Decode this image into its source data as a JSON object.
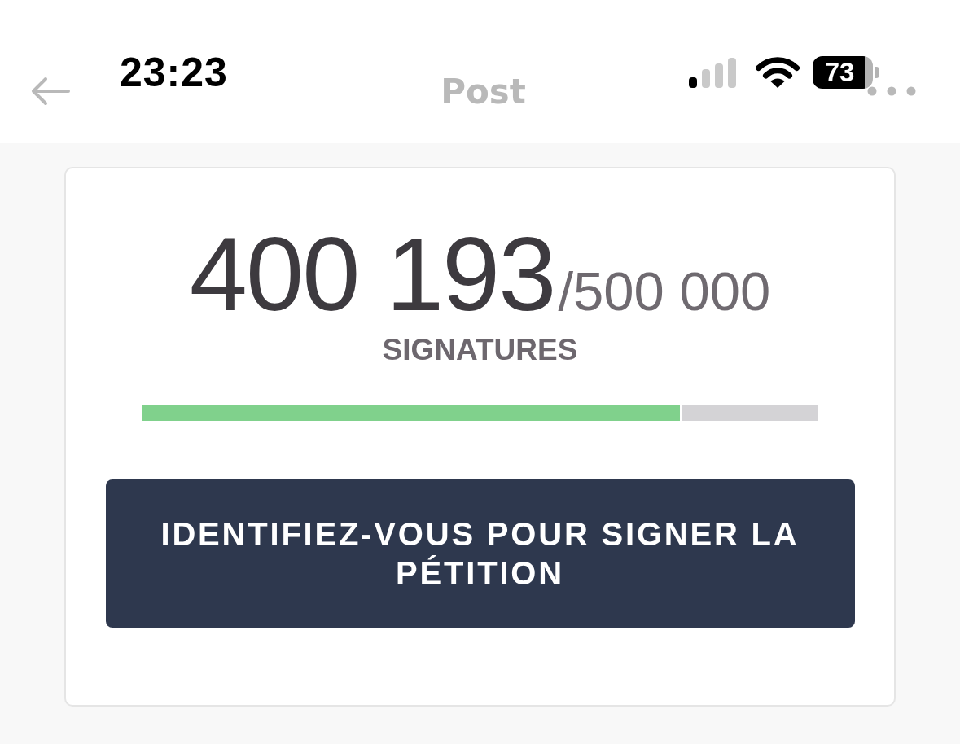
{
  "status_bar": {
    "time": "23:23",
    "battery": "73"
  },
  "nav_bar": {
    "title": "Post"
  },
  "petition": {
    "count": "400 193",
    "goal": "/500 000",
    "label": "SIGNATURES",
    "progress": {
      "level": 0.8
    },
    "button": "IDENTIFIEZ-VOUS POUR SIGNER LA PÉTITION"
  }
}
